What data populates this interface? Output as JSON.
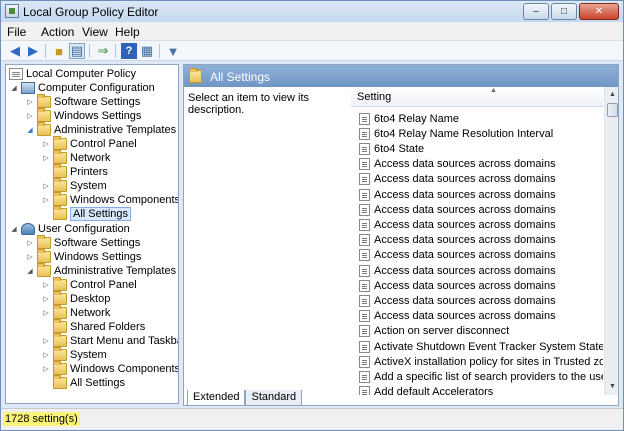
{
  "window": {
    "title": "Local Group Policy Editor"
  },
  "menu": [
    "File",
    "Action",
    "View",
    "Help"
  ],
  "toolbar": {
    "buttons": [
      "back-arrow-icon",
      "forward-arrow-icon",
      "up-folder-icon",
      "show-hide-tree-icon",
      "export-list-icon",
      "help-icon",
      "properties-icon",
      "filter-icon"
    ]
  },
  "tree": {
    "root": "Local Computer Policy",
    "computer_config": "Computer Configuration",
    "cc_software": "Software Settings",
    "cc_windows": "Windows Settings",
    "cc_admin": "Administrative Templates",
    "cc_control_panel": "Control Panel",
    "cc_network": "Network",
    "cc_printers": "Printers",
    "cc_system": "System",
    "cc_windows_components": "Windows Components",
    "cc_all_settings": "All Settings",
    "user_config": "User Configuration",
    "uc_software": "Software Settings",
    "uc_windows": "Windows Settings",
    "uc_admin": "Administrative Templates",
    "uc_control_panel": "Control Panel",
    "uc_desktop": "Desktop",
    "uc_network": "Network",
    "uc_shared_folders": "Shared Folders",
    "uc_start_menu": "Start Menu and Taskbar",
    "uc_system": "System",
    "uc_windows_components": "Windows Components",
    "uc_all_settings": "All Settings"
  },
  "details": {
    "header_title": "All Settings",
    "description": "Select an item to view its description.",
    "column_header": "Setting",
    "rows": [
      "6to4 Relay Name",
      "6to4 Relay Name Resolution Interval",
      "6to4 State",
      "Access data sources across domains",
      "Access data sources across domains",
      "Access data sources across domains",
      "Access data sources across domains",
      "Access data sources across domains",
      "Access data sources across domains",
      "Access data sources across domains",
      "Access data sources across domains",
      "Access data sources across domains",
      "Access data sources across domains",
      "Access data sources across domains",
      "Action on server disconnect",
      "Activate Shutdown Event Tracker System State Data feature",
      "ActiveX installation policy for sites in Trusted zones",
      "Add a specific list of search providers to the user's list of search providers",
      "Add default Accelerators"
    ]
  },
  "tabs": {
    "extended": "Extended",
    "standard": "Standard"
  },
  "status": {
    "text": "1728 setting(s)"
  }
}
